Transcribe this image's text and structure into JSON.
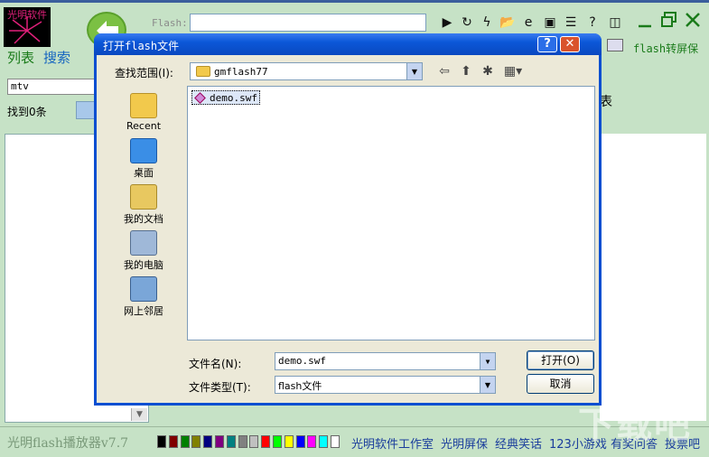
{
  "app": {
    "logo_text": "光明软件",
    "flash_label": "Flash:",
    "flash_value": "",
    "tabs": {
      "list": "列表",
      "search": "搜索"
    },
    "to_screensaver": "flash转屏保",
    "side_text": "表"
  },
  "left_panel": {
    "search_value": "mtv",
    "found_label": "找到0条"
  },
  "dialog": {
    "title": "打开flash文件",
    "help_label": "?",
    "close_label": "✕",
    "lookin_label": "查找范围(I):",
    "lookin_value": "gmflash77",
    "places": [
      "Recent",
      "桌面",
      "我的文档",
      "我的电脑",
      "网上邻居"
    ],
    "files": [
      "demo.swf"
    ],
    "filename_label": "文件名(N):",
    "filename_value": "demo.swf",
    "filetype_label": "文件类型(T):",
    "filetype_value": "flash文件",
    "open_button": "打开(O)",
    "cancel_button": "取消"
  },
  "bottom": {
    "app_title": "光明flash播放器v7.7",
    "swatch_colors": [
      "#000000",
      "#800000",
      "#008000",
      "#808000",
      "#000080",
      "#800080",
      "#008080",
      "#808080",
      "#c0c0c0",
      "#ff0000",
      "#00ff00",
      "#ffff00",
      "#0000ff",
      "#ff00ff",
      "#00ffff",
      "#ffffff"
    ],
    "links": [
      "光明软件工作室",
      "光明屏保",
      "经典笑话",
      "123小游戏",
      "有奖问答",
      "投票吧"
    ]
  },
  "watermark": "下载吧"
}
